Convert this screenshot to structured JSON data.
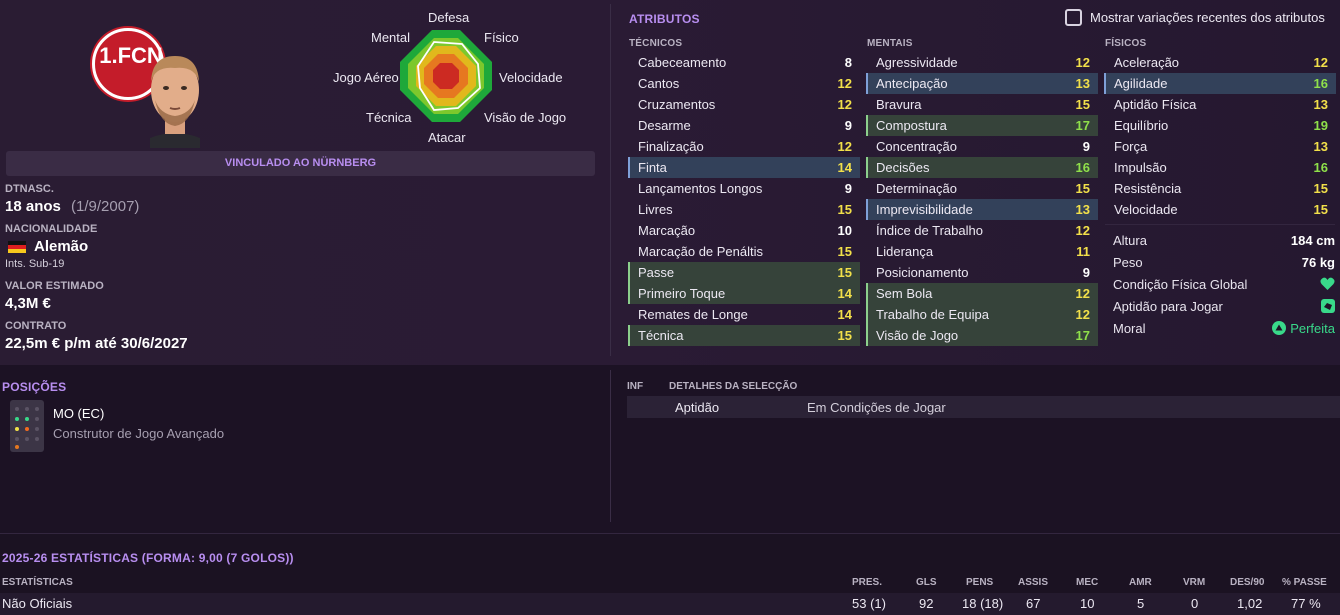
{
  "player": {
    "club_banner": "VINCULADO AO NÜRNBERG",
    "club_badge_text": "1.FCN",
    "dob_label": "DTNASC.",
    "age": "18 anos",
    "dob": "(1/9/2007)",
    "nationality_label": "NACIONALIDADE",
    "nationality": "Alemão",
    "intl_caps": "Ints. Sub-19",
    "value_label": "VALOR ESTIMADO",
    "value": "4,3M €",
    "contract_label": "CONTRATO",
    "contract": "22,5m € p/m até 30/6/2027"
  },
  "radar": {
    "labels": {
      "top": "Defesa",
      "top_left": "Mental",
      "top_right": "Físico",
      "left": "Jogo Aéreo",
      "right": "Velocidade",
      "bottom_left": "Técnica",
      "bottom_right": "Visão de Jogo",
      "bottom": "Atacar"
    }
  },
  "attributes": {
    "title": "ATRIBUTOS",
    "toggle_label": "Mostrar variações recentes dos atributos",
    "technical_title": "TÉCNICOS",
    "mental_title": "MENTAIS",
    "physical_title": "FÍSICOS",
    "technical": [
      {
        "name": "Cabeceamento",
        "value": "8"
      },
      {
        "name": "Cantos",
        "value": "12"
      },
      {
        "name": "Cruzamentos",
        "value": "12"
      },
      {
        "name": "Desarme",
        "value": "9"
      },
      {
        "name": "Finalização",
        "value": "12"
      },
      {
        "name": "Finta",
        "value": "14"
      },
      {
        "name": "Lançamentos Longos",
        "value": "9"
      },
      {
        "name": "Livres",
        "value": "15"
      },
      {
        "name": "Marcação",
        "value": "10"
      },
      {
        "name": "Marcação de Penáltis",
        "value": "15"
      },
      {
        "name": "Passe",
        "value": "15"
      },
      {
        "name": "Primeiro Toque",
        "value": "14"
      },
      {
        "name": "Remates de Longe",
        "value": "14"
      },
      {
        "name": "Técnica",
        "value": "15"
      }
    ],
    "mental": [
      {
        "name": "Agressividade",
        "value": "12"
      },
      {
        "name": "Antecipação",
        "value": "13"
      },
      {
        "name": "Bravura",
        "value": "15"
      },
      {
        "name": "Compostura",
        "value": "17"
      },
      {
        "name": "Concentração",
        "value": "9"
      },
      {
        "name": "Decisões",
        "value": "16"
      },
      {
        "name": "Determinação",
        "value": "15"
      },
      {
        "name": "Imprevisibilidade",
        "value": "13"
      },
      {
        "name": "Índice de Trabalho",
        "value": "12"
      },
      {
        "name": "Liderança",
        "value": "11"
      },
      {
        "name": "Posicionamento",
        "value": "9"
      },
      {
        "name": "Sem Bola",
        "value": "12"
      },
      {
        "name": "Trabalho de Equipa",
        "value": "12"
      },
      {
        "name": "Visão de Jogo",
        "value": "17"
      }
    ],
    "physical": [
      {
        "name": "Aceleração",
        "value": "12"
      },
      {
        "name": "Agilidade",
        "value": "16"
      },
      {
        "name": "Aptidão Física",
        "value": "13"
      },
      {
        "name": "Equilíbrio",
        "value": "19"
      },
      {
        "name": "Força",
        "value": "13"
      },
      {
        "name": "Impulsão",
        "value": "16"
      },
      {
        "name": "Resistência",
        "value": "15"
      },
      {
        "name": "Velocidade",
        "value": "15"
      }
    ],
    "extra": {
      "height_label": "Altura",
      "height": "184 cm",
      "weight_label": "Peso",
      "weight": "76 kg",
      "fitness_label": "Condição Física Global",
      "match_fit_label": "Aptidão para Jogar",
      "morale_label": "Moral",
      "morale": "Perfeita"
    }
  },
  "positions": {
    "title": "POSIÇÕES",
    "primary": "MO (EC)",
    "role": "Construtor de Jogo Avançado"
  },
  "selection": {
    "col1": "INF",
    "col2": "DETALHES DA SELECÇÃO",
    "row_label": "Aptidão",
    "row_value": "Em Condições de Jogar"
  },
  "stats": {
    "title": "2025-26 ESTATÍSTICAS (FORMA: 9,00 (7 GOLOS))",
    "col_label": "ESTATÍSTICAS",
    "headers": [
      "PRES.",
      "GLS",
      "PENS",
      "ASSIS",
      "MEC",
      "AMR",
      "VRM",
      "DES/90",
      "% PASSE"
    ],
    "row_label": "Não Oficiais",
    "row_values": [
      "53 (1)",
      "92",
      "18 (18)",
      "67",
      "10",
      "5",
      "0",
      "1,02",
      "77 %"
    ]
  },
  "colors": {
    "accent": "#b88ef0",
    "good": "#8fe04a",
    "mid": "#f2e04a",
    "highlight_blue": "#33415a",
    "highlight_green": "#36433a"
  }
}
